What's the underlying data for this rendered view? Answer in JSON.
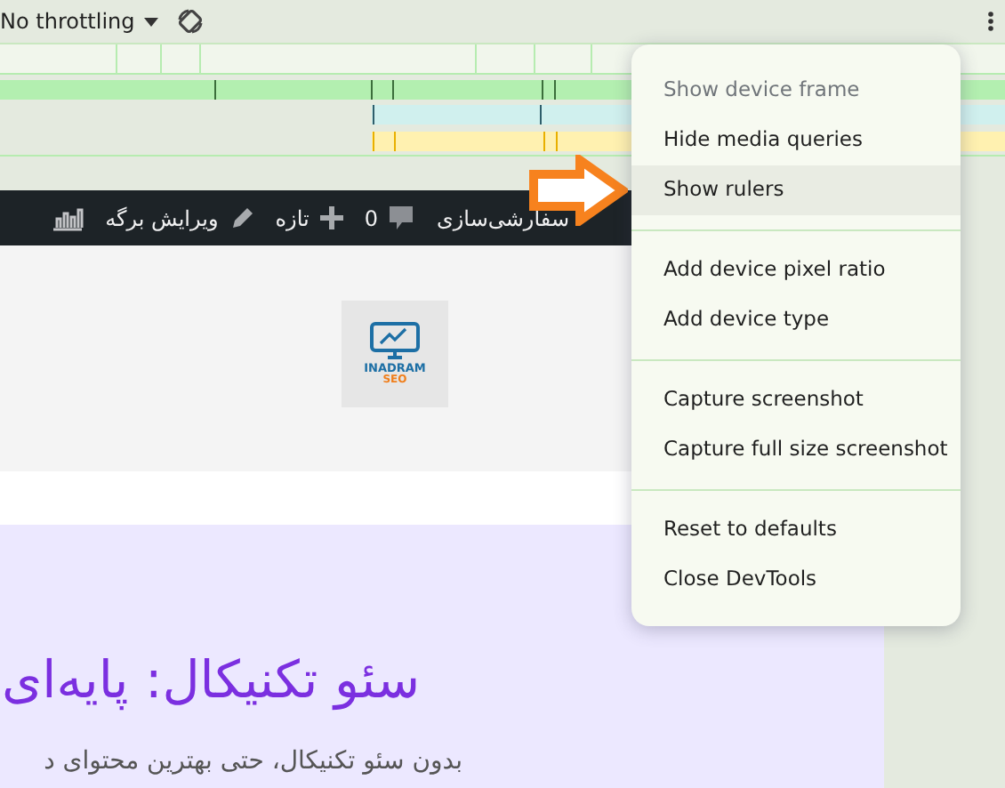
{
  "toolbar": {
    "throttling": {
      "label": "No throttling"
    }
  },
  "admin_bar": {
    "items": [
      {
        "kind": "text",
        "label": "سفارشی‌سازی"
      },
      {
        "kind": "comments",
        "label": "0"
      },
      {
        "kind": "new",
        "label": "تازه"
      },
      {
        "kind": "edit",
        "label": "ویرایش برگه"
      },
      {
        "kind": "stats"
      }
    ]
  },
  "logo": {
    "line_1": "INADRAM",
    "line_2": "SEO"
  },
  "hero": {
    "heading": "سئو تکنیکال: پایه‌ای",
    "text": "بدون سئو تکنیکال، حتی بهترین محتوای د"
  },
  "menu": {
    "groups": [
      [
        {
          "label": "Show device frame",
          "disabled": true,
          "selected": false
        },
        {
          "label": "Hide media queries",
          "disabled": false,
          "selected": false
        },
        {
          "label": "Show rulers",
          "disabled": false,
          "selected": true
        }
      ],
      [
        {
          "label": "Add device pixel ratio",
          "disabled": false,
          "selected": false
        },
        {
          "label": "Add device type",
          "disabled": false,
          "selected": false
        }
      ],
      [
        {
          "label": "Capture screenshot",
          "disabled": false,
          "selected": false
        },
        {
          "label": "Capture full size screenshot",
          "disabled": false,
          "selected": false
        }
      ],
      [
        {
          "label": "Reset to defaults",
          "disabled": false,
          "selected": false
        },
        {
          "label": "Close DevTools",
          "disabled": false,
          "selected": false
        }
      ]
    ]
  }
}
